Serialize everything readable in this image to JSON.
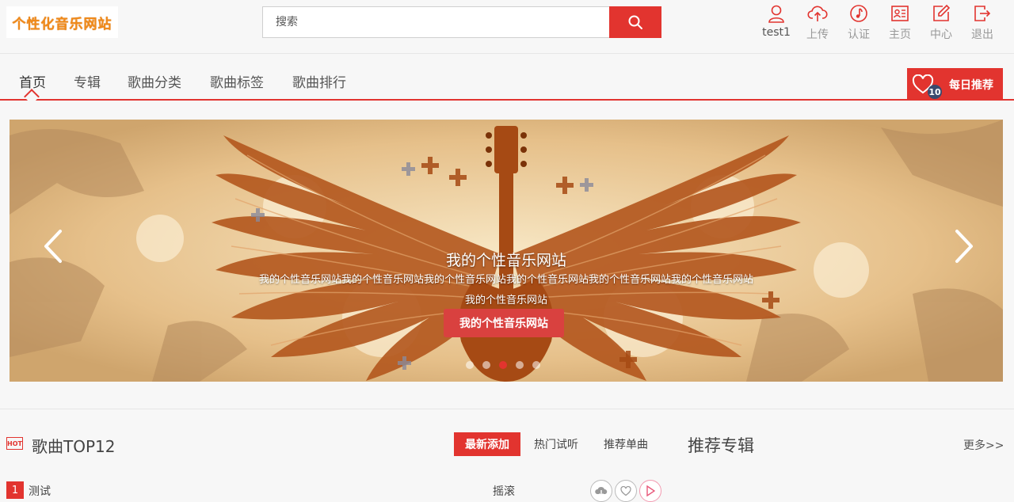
{
  "header": {
    "logo_text": "个性化音乐网站",
    "search": {
      "placeholder": "搜索"
    },
    "nav": [
      {
        "label": "test1",
        "icon": "user-icon"
      },
      {
        "label": "上传",
        "icon": "cloud-upload-icon"
      },
      {
        "label": "认证",
        "icon": "music-note-icon"
      },
      {
        "label": "主页",
        "icon": "id-card-icon"
      },
      {
        "label": "中心",
        "icon": "edit-icon"
      },
      {
        "label": "退出",
        "icon": "logout-icon"
      }
    ]
  },
  "tabs": [
    {
      "label": "首页",
      "active": true
    },
    {
      "label": "专辑",
      "active": false
    },
    {
      "label": "歌曲分类",
      "active": false
    },
    {
      "label": "歌曲标签",
      "active": false
    },
    {
      "label": "歌曲排行",
      "active": false
    }
  ],
  "daily": {
    "count": "10",
    "label": "每日推荐"
  },
  "banner": {
    "title": "我的个性音乐网站",
    "desc_line1": "我的个性音乐网站我的个性音乐网站我的个性音乐网站我的个性音乐网站我的个性音乐网站我的个性音乐网站",
    "desc_line2": "我的个性音乐网站",
    "button": "我的个性音乐网站",
    "slide_count": 5,
    "active_slide": 3
  },
  "section": {
    "hot_badge": "HOT",
    "title": "歌曲TOP12",
    "sub_tabs": [
      "最新添加",
      "热门试听",
      "推荐单曲"
    ],
    "album_title": "推荐专辑",
    "more": "更多>>"
  },
  "songs": [
    {
      "rank": "1",
      "name": "测试",
      "genre": "摇滚"
    }
  ],
  "colors": {
    "accent": "#e2342f",
    "badge": "#3a4a6e"
  }
}
